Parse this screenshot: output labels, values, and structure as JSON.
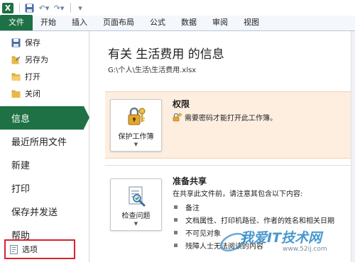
{
  "qat": {
    "app_icon": "excel-icon",
    "icons": [
      "save-icon",
      "undo-icon",
      "redo-icon",
      "customize-icon"
    ]
  },
  "tabs": [
    {
      "label": "文件"
    },
    {
      "label": "开始"
    },
    {
      "label": "插入"
    },
    {
      "label": "页面布局"
    },
    {
      "label": "公式"
    },
    {
      "label": "数据"
    },
    {
      "label": "审阅"
    },
    {
      "label": "视图"
    }
  ],
  "nav": {
    "save": "保存",
    "save_as": "另存为",
    "open": "打开",
    "close": "关闭",
    "info": "信息",
    "recent": "最近所用文件",
    "new": "新建",
    "print": "打印",
    "save_send": "保存并发送",
    "help": "帮助",
    "options": "选项"
  },
  "main": {
    "title": "有关 生活费用 的信息",
    "path": "G:\\个人\\生活\\生活费用.xlsx",
    "permissions": {
      "button_label": "保护工作簿",
      "heading": "权限",
      "description": "需要密码才能打开此工作簿。"
    },
    "prepare": {
      "button_label": "检查问题",
      "heading": "准备共享",
      "description": "在共享此文件前，请注意其包含以下内容:",
      "items": [
        "备注",
        "文档属性、打印机路径、作者的姓名和相关日期",
        "不可见对象",
        "残障人士无法阅读的内容"
      ]
    }
  },
  "watermark": {
    "text": "我爱IT技术网",
    "url": "www.52ij.com"
  },
  "colors": {
    "accent": "#1e7145",
    "permissions_bg": "#fdeee0",
    "highlight_border": "#d8232a"
  }
}
